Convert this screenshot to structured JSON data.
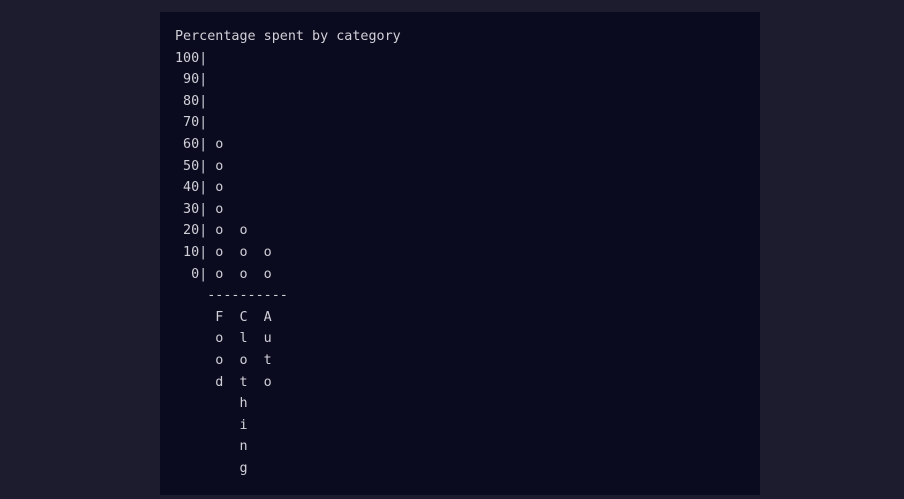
{
  "output": {
    "lines": [
      "Percentage spent by category",
      "100|          ",
      " 90|          ",
      " 80|          ",
      " 70|          ",
      " 60| o        ",
      " 50| o        ",
      " 40| o        ",
      " 30| o        ",
      " 20| o  o     ",
      " 10| o  o  o  ",
      "  0| o  o  o  ",
      "    ----------",
      "     F  C  A  ",
      "     o  l  u  ",
      "     o  o  t  ",
      "     d  t  o  ",
      "        h     ",
      "        i     ",
      "        n     ",
      "        g     "
    ]
  },
  "colors": {
    "page_background": "#1c1c2e",
    "panel_background": "#0b0b1f",
    "text": "#d0d0d8"
  }
}
